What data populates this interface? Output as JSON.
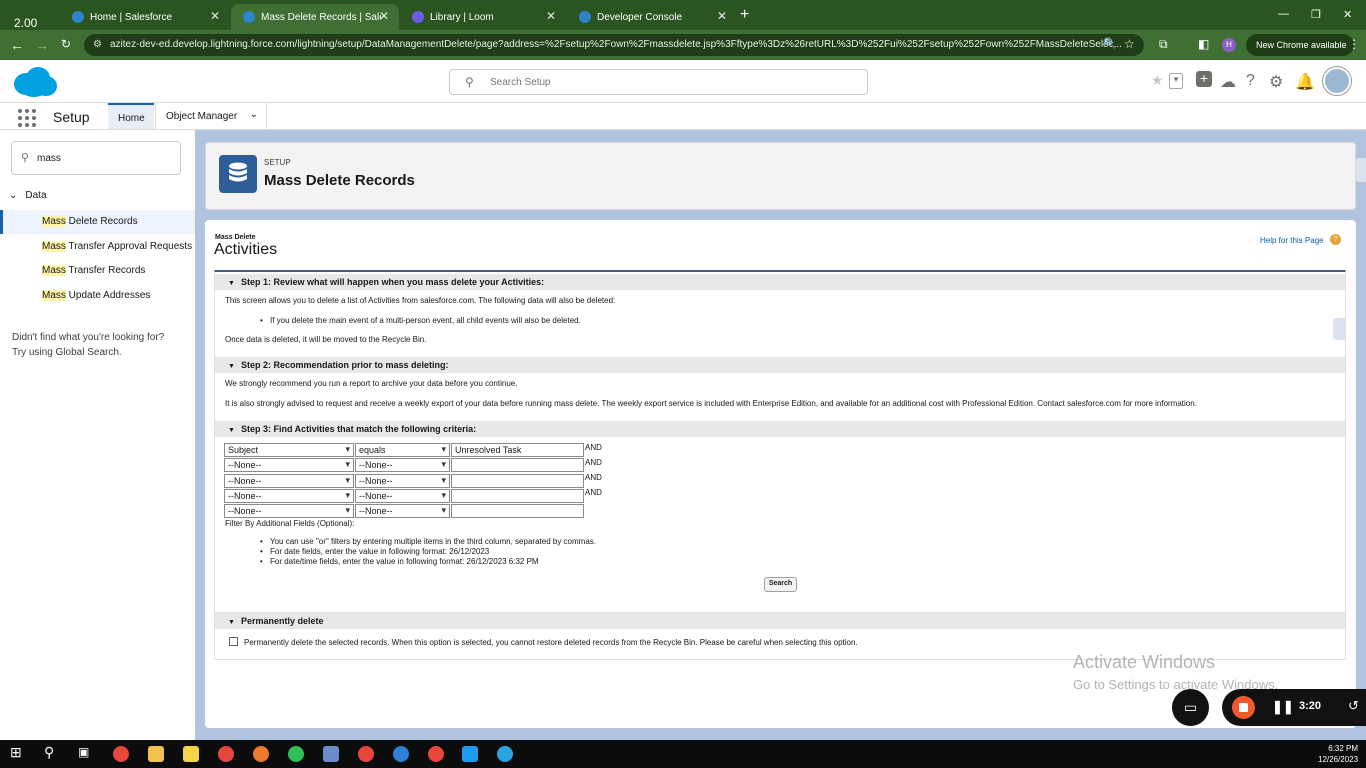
{
  "browser": {
    "zoom_badge": "2.00",
    "tabs": [
      {
        "label": "Home | Salesforce",
        "color": "#2e84c8"
      },
      {
        "label": "Mass Delete Records | Salesforc",
        "color": "#2e84c8"
      },
      {
        "label": "Library | Loom",
        "color": "#6f5ce6"
      },
      {
        "label": "Developer Console",
        "color": "#2e84c8"
      }
    ],
    "url": "azitez-dev-ed.develop.lightning.force.com/lightning/setup/DataManagementDelete/page?address=%2Fsetup%2Fown%2Fmassdelete.jsp%3Fftype%3Dz%26retURL%3D%252Fui%252Fsetup%252Fown%252FMassDeleteSelec...",
    "new_chrome": "New Chrome available",
    "profile_initial": "H"
  },
  "sf": {
    "search_placeholder": "Search Setup",
    "app_title": "Setup",
    "nav_tabs": [
      "Home",
      "Object Manager"
    ]
  },
  "sidebar": {
    "quick_find_value": "mass",
    "tree_head": "Data",
    "items": [
      {
        "hl": "Mass",
        "rest": " Delete Records"
      },
      {
        "hl": "Mass",
        "rest": " Transfer Approval Requests"
      },
      {
        "hl": "Mass",
        "rest": " Transfer Records"
      },
      {
        "hl": "Mass",
        "rest": " Update Addresses"
      }
    ],
    "foot_line1": "Didn't find what you're looking for?",
    "foot_line2": "Try using Global Search."
  },
  "header": {
    "kicker": "SETUP",
    "title": "Mass Delete Records"
  },
  "main": {
    "kicker": "Mass Delete",
    "title": "Activities",
    "help": "Help for this Page",
    "step1_title": "Step 1: Review what will happen when you mass delete your Activities:",
    "step1_text": "This screen allows you to delete a list of Activities from salesforce.com. The following data will also be deleted:",
    "step1_bullet": "If you delete the main event of a multi-person event, all child events will also be deleted.",
    "step1_text2": "Once data is deleted, it will be moved to the Recycle Bin.",
    "step2_title": "Step 2: Recommendation prior to mass deleting:",
    "step2_text1": "We strongly recommend you run a report to archive your data before you continue.",
    "step2_text2": "It is also strongly advised to request and receive a weekly export of your data before running mass delete. The weekly export service is included with Enterprise Edition, and available for an additional cost with Professional Edition. Contact salesforce.com for more information.",
    "step3_title": "Step 3: Find Activities that match the following criteria:",
    "criteria": [
      {
        "field": "Subject",
        "op": "equals",
        "value": "Unresolved Task",
        "join": "AND"
      },
      {
        "field": "--None--",
        "op": "--None--",
        "value": "",
        "join": "AND"
      },
      {
        "field": "--None--",
        "op": "--None--",
        "value": "",
        "join": "AND"
      },
      {
        "field": "--None--",
        "op": "--None--",
        "value": "",
        "join": "AND"
      },
      {
        "field": "--None--",
        "op": "--None--",
        "value": "",
        "join": ""
      }
    ],
    "filter_label": "Filter By Additional Fields (Optional):",
    "tips": [
      "You can use \"or\" filters by entering multiple items in the third column, separated by commas.",
      "For date fields, enter the value in following format: 26/12/2023",
      "For date/time fields, enter the value in following format: 26/12/2023 6:32 PM"
    ],
    "search_button": "Search",
    "perm_title": "Permanently delete",
    "perm_text": "Permanently delete the selected records. When this option is selected, you cannot restore deleted records from the Recycle Bin. Please be careful when selecting this option."
  },
  "watermark": {
    "line1": "Activate Windows",
    "line2": "Go to Settings to activate Windows."
  },
  "loom": {
    "time": "3:20"
  },
  "taskbar": {
    "time": "6:32 PM",
    "date": "12/26/2023"
  }
}
